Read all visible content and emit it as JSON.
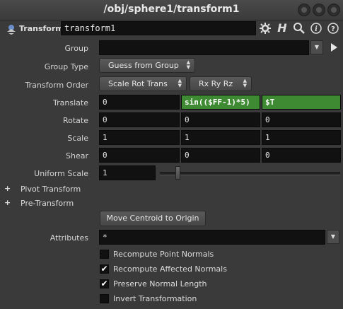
{
  "window": {
    "title": "/obj/sphere1/transform1"
  },
  "header": {
    "node_type": "Transform",
    "node_name": "transform1"
  },
  "params": {
    "group_label": "Group",
    "group_value": "",
    "group_type_label": "Group Type",
    "group_type_value": "Guess from Group",
    "transform_order_label": "Transform Order",
    "transform_order_value": "Scale Rot Trans",
    "rotation_order_value": "Rx Ry Rz",
    "translate_label": "Translate",
    "translate": [
      "0",
      "sin(($FF-1)*5)",
      "$T"
    ],
    "rotate_label": "Rotate",
    "rotate": [
      "0",
      "0",
      "0"
    ],
    "scale_label": "Scale",
    "scale": [
      "1",
      "1",
      "1"
    ],
    "shear_label": "Shear",
    "shear": [
      "0",
      "0",
      "0"
    ],
    "uniform_scale_label": "Uniform Scale",
    "uniform_scale_value": "1",
    "uniform_scale_fraction": 0.1,
    "pivot_transform_label": "Pivot Transform",
    "pre_transform_label": "Pre-Transform",
    "move_centroid_label": "Move Centroid to Origin",
    "attributes_label": "Attributes",
    "attributes_value": "*"
  },
  "checkboxes": [
    {
      "label": "Recompute Point Normals",
      "checked": false
    },
    {
      "label": "Recompute Affected Normals",
      "checked": true
    },
    {
      "label": "Preserve Normal Length",
      "checked": true
    },
    {
      "label": "Invert Transformation",
      "checked": false
    }
  ],
  "colors": {
    "expression_green": "#3e8a32",
    "background": "#3a3a3a",
    "field": "#111111"
  },
  "icons": [
    "gear-icon",
    "help-h-icon",
    "search-icon",
    "info-icon",
    "question-icon",
    "pin-arrow-icon"
  ]
}
